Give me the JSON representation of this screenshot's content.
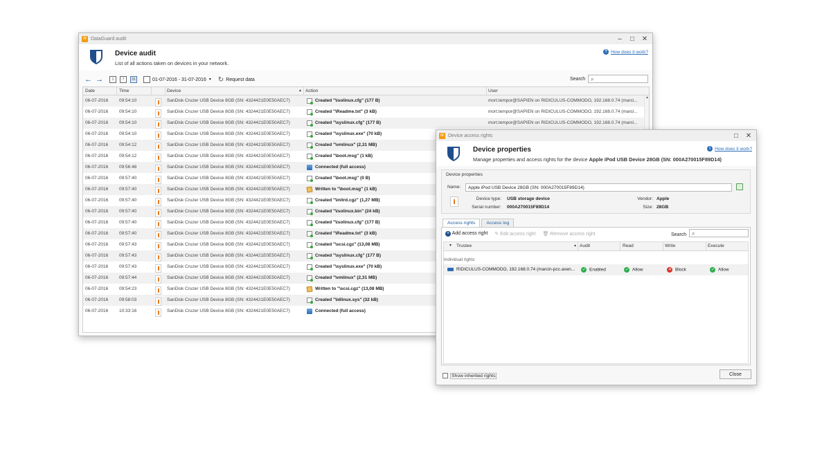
{
  "audit_window": {
    "title": "DataGuard audit",
    "header_title": "Device audit",
    "header_subtitle": "List of all actions taken on devices in your network.",
    "help_link": "How does it work?",
    "toolbar": {
      "date_range": "01-07-2016 - 31-07-2016",
      "request_label": "Request data",
      "search_label": "Search",
      "search_value": ""
    },
    "columns": {
      "date": "Date",
      "time": "Time",
      "device": "Device",
      "action": "Action",
      "user": "User"
    },
    "rows": [
      {
        "date": "06-07-2016",
        "time": "09:54:10",
        "device": "SanDisk Cruzer USB Device 8GB (SN: 4324421E0E50AEC7)",
        "action": "Created \"\\isolinux.cfg\" (177 B)",
        "type": "file",
        "user": "mort.tempor@SAPIEN on RIDICULUS-COMMODO, 192.168.0.74 (marci..."
      },
      {
        "date": "06-07-2016",
        "time": "09:54:10",
        "device": "SanDisk Cruzer USB Device 8GB (SN: 4324421E0E50AEC7)",
        "action": "Created \"\\Readme.txt\" (3 kB)",
        "type": "file",
        "user": "mort.tempor@SAPIEN on RIDICULUS-COMMODO, 192.168.0.74 (marci..."
      },
      {
        "date": "06-07-2016",
        "time": "09:54:10",
        "device": "SanDisk Cruzer USB Device 8GB (SN: 4324421E0E50AEC7)",
        "action": "Created \"\\syslinux.cfg\" (177 B)",
        "type": "file",
        "user": "mort.tempor@SAPIEN on RIDICULUS-COMMODO, 192.168.0.74 (marci..."
      },
      {
        "date": "06-07-2016",
        "time": "09:54:10",
        "device": "SanDisk Cruzer USB Device 8GB (SN: 4324421E0E50AEC7)",
        "action": "Created \"\\syslinux.exe\" (70 kB)",
        "type": "file",
        "user": ""
      },
      {
        "date": "06-07-2016",
        "time": "09:54:12",
        "device": "SanDisk Cruzer USB Device 8GB (SN: 4324421E0E50AEC7)",
        "action": "Created \"\\vmlinux\" (2,31 MB)",
        "type": "file",
        "user": ""
      },
      {
        "date": "06-07-2016",
        "time": "09:54:12",
        "device": "SanDisk Cruzer USB Device 8GB (SN: 4324421E0E50AEC7)",
        "action": "Created \"\\boot.msg\" (1 kB)",
        "type": "file",
        "user": ""
      },
      {
        "date": "06-07-2016",
        "time": "09:56:48",
        "device": "SanDisk Cruzer USB Device 8GB (SN: 4324421E0E50AEC7)",
        "action": "Connected (full access)",
        "type": "conn",
        "user": ""
      },
      {
        "date": "06-07-2016",
        "time": "09:57:40",
        "device": "SanDisk Cruzer USB Device 8GB (SN: 4324421E0E50AEC7)",
        "action": "Created \"\\boot.msg\" (0 B)",
        "type": "file",
        "user": ""
      },
      {
        "date": "06-07-2016",
        "time": "09:57:40",
        "device": "SanDisk Cruzer USB Device 8GB (SN: 4324421E0E50AEC7)",
        "action": "Written to \"\\boot.msg\" (1 kB)",
        "type": "write",
        "user": ""
      },
      {
        "date": "06-07-2016",
        "time": "09:57:40",
        "device": "SanDisk Cruzer USB Device 8GB (SN: 4324421E0E50AEC7)",
        "action": "Created \"\\initrd.cgz\" (1,27 MB)",
        "type": "file",
        "user": ""
      },
      {
        "date": "06-07-2016",
        "time": "09:57:40",
        "device": "SanDisk Cruzer USB Device 8GB (SN: 4324421E0E50AEC7)",
        "action": "Created \"\\isolinux.bin\" (24 kB)",
        "type": "file",
        "user": ""
      },
      {
        "date": "06-07-2016",
        "time": "09:57:40",
        "device": "SanDisk Cruzer USB Device 8GB (SN: 4324421E0E50AEC7)",
        "action": "Created \"\\isolinux.cfg\" (177 B)",
        "type": "file",
        "user": ""
      },
      {
        "date": "06-07-2016",
        "time": "09:57:40",
        "device": "SanDisk Cruzer USB Device 8GB (SN: 4324421E0E50AEC7)",
        "action": "Created \"\\Readme.txt\" (3 kB)",
        "type": "file",
        "user": ""
      },
      {
        "date": "06-07-2016",
        "time": "09:57:43",
        "device": "SanDisk Cruzer USB Device 8GB (SN: 4324421E0E50AEC7)",
        "action": "Created \"\\scsi.cgz\" (13,08 MB)",
        "type": "file",
        "user": ""
      },
      {
        "date": "06-07-2016",
        "time": "09:57:43",
        "device": "SanDisk Cruzer USB Device 8GB (SN: 4324421E0E50AEC7)",
        "action": "Created \"\\syslinux.cfg\" (177 B)",
        "type": "file",
        "user": ""
      },
      {
        "date": "06-07-2016",
        "time": "09:57:43",
        "device": "SanDisk Cruzer USB Device 8GB (SN: 4324421E0E50AEC7)",
        "action": "Created \"\\syslinux.exe\" (70 kB)",
        "type": "file",
        "user": ""
      },
      {
        "date": "06-07-2016",
        "time": "09:57:44",
        "device": "SanDisk Cruzer USB Device 8GB (SN: 4324421E0E50AEC7)",
        "action": "Created \"\\vmlinux\" (2,31 MB)",
        "type": "file",
        "user": ""
      },
      {
        "date": "06-07-2016",
        "time": "09:54:23",
        "device": "SanDisk Cruzer USB Device 8GB (SN: 4324421E0E50AEC7)",
        "action": "Written to \"\\scsi.cgz\" (13,08 MB)",
        "type": "write",
        "user": ""
      },
      {
        "date": "06-07-2016",
        "time": "09:58:03",
        "device": "SanDisk Cruzer USB Device 8GB (SN: 4324421E0E50AEC7)",
        "action": "Created \"\\ldlinux.sys\" (32 kB)",
        "type": "file",
        "user": ""
      },
      {
        "date": "06-07-2016",
        "time": "10:33:16",
        "device": "SanDisk Cruzer USB Device 8GB (SN: 4324421E0E50AEC7)",
        "action": "Connected (full access)",
        "type": "conn",
        "user": ""
      }
    ]
  },
  "dialog": {
    "title": "Device access rights",
    "header_title": "Device properties",
    "header_subtitle_prefix": "Manage properties and access rights for the device ",
    "header_subtitle_device": "Apple iPod USB Device 28GB (SN: 000A270015F89D14)",
    "help_link": "How does it work?",
    "group_title": "Device properties",
    "name_label": "Name:",
    "name_value": "Apple iPod USB Device 28GB (SN: 000A270015F89D14)",
    "device_type_label": "Device type:",
    "device_type_value": "USB storage device",
    "serial_label": "Serial number:",
    "serial_value": "000A270015F89D14",
    "vendor_label": "Vendor:",
    "vendor_value": "Apple",
    "size_label": "Size:",
    "size_value": "28GB",
    "tabs": [
      "Access rights",
      "Access log"
    ],
    "add_label": "Add access right",
    "edit_label": "Edit access right",
    "remove_label": "Remove access right",
    "search_label": "Search",
    "columns": {
      "trustee": "Trustee",
      "audit": "Audit",
      "read": "Read",
      "write": "Write",
      "execute": "Execute"
    },
    "section_label": "Individual rights",
    "rights": [
      {
        "trustee": "RIDICULUS-COMMODO, 192.168.0.74 (marcin-pcc.axen...",
        "audit": "Enabled",
        "read": "Allow",
        "write": "Block",
        "execute": "Allow"
      }
    ],
    "inherited_label": "Show inherited rights",
    "close_label": "Close"
  }
}
